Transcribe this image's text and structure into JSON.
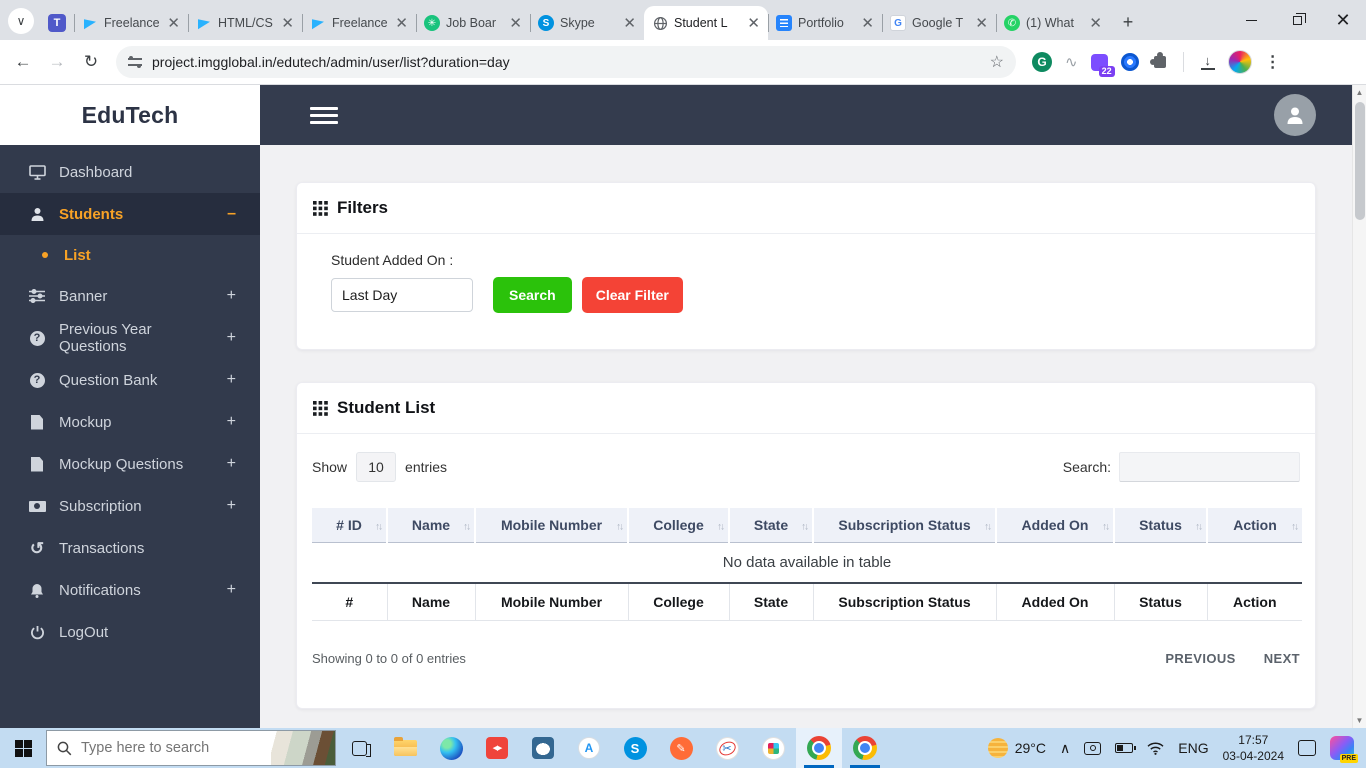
{
  "browser": {
    "pinned_tab": {
      "icon": "teams-icon"
    },
    "tabs": [
      {
        "label": "Freelance",
        "icon": "freelancer-icon"
      },
      {
        "label": "HTML/CS",
        "icon": "freelancer-icon"
      },
      {
        "label": "Freelance",
        "icon": "freelancer-icon"
      },
      {
        "label": "Job Boar",
        "icon": "chatgpt-icon"
      },
      {
        "label": "Skype",
        "icon": "skype-icon"
      },
      {
        "label": "Student L",
        "icon": "globe-icon",
        "active": true
      },
      {
        "label": "Portfolio",
        "icon": "docs-icon"
      },
      {
        "label": "Google T",
        "icon": "translate-icon"
      },
      {
        "label": "(1) What",
        "icon": "whatsapp-icon"
      }
    ],
    "url": "project.imgglobal.in/edutech/admin/user/list?duration=day",
    "extensions": {
      "badge_count": "22"
    }
  },
  "app": {
    "logo": "EduTech",
    "sidebar": {
      "items": [
        {
          "label": "Dashboard",
          "icon": "monitor-icon",
          "expand": ""
        },
        {
          "label": "Students",
          "icon": "user-icon",
          "expand": "–",
          "active": true
        },
        {
          "label": "List",
          "icon": "bullet",
          "sub": true,
          "active": true
        },
        {
          "label": "Banner",
          "icon": "sliders-icon",
          "expand": "+"
        },
        {
          "label": "Previous Year Questions",
          "icon": "question-icon",
          "expand": "+"
        },
        {
          "label": "Question Bank",
          "icon": "question-icon",
          "expand": "+"
        },
        {
          "label": "Mockup",
          "icon": "file-icon",
          "expand": "+"
        },
        {
          "label": "Mockup Questions",
          "icon": "file-icon",
          "expand": "+"
        },
        {
          "label": "Subscription",
          "icon": "banknote-icon",
          "expand": "+"
        },
        {
          "label": "Transactions",
          "icon": "history-icon",
          "expand": ""
        },
        {
          "label": "Notifications",
          "icon": "bell-icon",
          "expand": "+"
        },
        {
          "label": "LogOut",
          "icon": "power-icon",
          "expand": ""
        }
      ]
    },
    "filters": {
      "title": "Filters",
      "label": "Student Added On :",
      "input_value": "Last Day",
      "search_button": "Search",
      "clear_button": "Clear Filter"
    },
    "student_list": {
      "title": "Student List",
      "show_label": "Show",
      "entries_value": "10",
      "entries_label": "entries",
      "search_label": "Search:",
      "search_value": "",
      "headers": [
        "# ID",
        "Name",
        "Mobile Number",
        "College",
        "State",
        "Subscription Status",
        "Added On",
        "Status",
        "Action"
      ],
      "footer": [
        "#",
        "Name",
        "Mobile Number",
        "College",
        "State",
        "Subscription Status",
        "Added On",
        "Status",
        "Action"
      ],
      "empty_text": "No data available in table",
      "info": "Showing 0 to 0 of 0 entries",
      "previous_label": "PREVIOUS",
      "next_label": "NEXT"
    }
  },
  "taskbar": {
    "search_placeholder": "Type here to search",
    "weather_temp": "29°C",
    "language": "ENG",
    "time": "17:57",
    "date": "03-04-2024",
    "copilot_badge": "PRE"
  },
  "icons": {
    "sort_asc": "↑",
    "sort_desc": "↓",
    "question_glyph": "?",
    "history_glyph": "↺",
    "chevron_down": "∨",
    "chevron_up": "∧",
    "teams_glyph": "T",
    "skype_glyph": "S",
    "grammarly_glyph": "G",
    "translate_glyph": "G",
    "chatgpt_glyph": "✳",
    "whatsapp_glyph": "✆",
    "compass_glyph": "A",
    "postman_glyph": "✎",
    "scissors_glyph": "✂",
    "anydesk_glyph": "◀▶"
  },
  "colors": {
    "accent_orange": "#f8a226",
    "button_green": "#2bc20b",
    "button_red": "#f44336",
    "sidebar_bg": "#323a4c",
    "topbar_bg": "#343c4e",
    "taskbar_bg": "#c3dcf2",
    "table_header_bg": "#eef1f8"
  }
}
